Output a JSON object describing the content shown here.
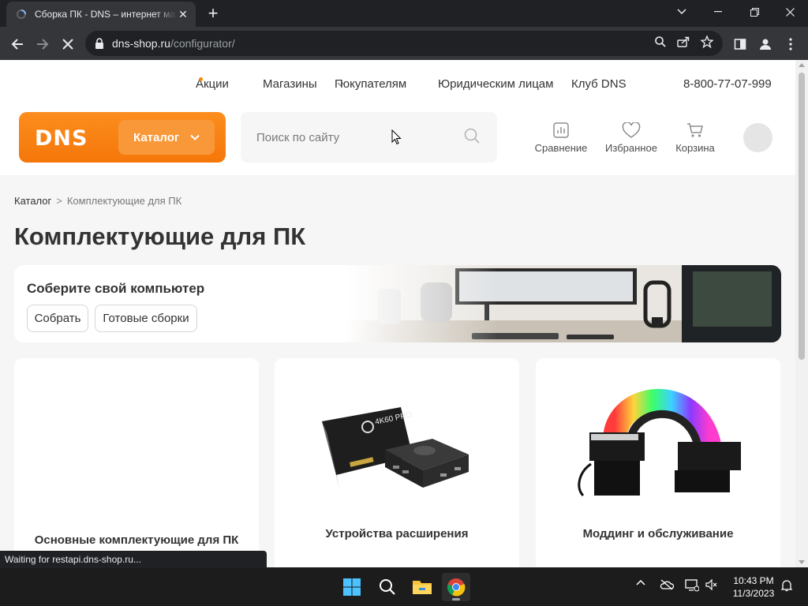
{
  "browser": {
    "tab_title": "Сборка ПК - DNS – интернет магазин",
    "url_domain": "dns-shop.ru",
    "url_path": "/configurator/",
    "status_text": "Waiting for restapi.dns-shop.ru..."
  },
  "site": {
    "brand_color": "#fc8507",
    "topnav": {
      "promo": "Акции",
      "stores": "Магазины",
      "buyers": "Покупателям",
      "legal": "Юридическим лицам",
      "club": "Клуб DNS",
      "phone": "8-800-77-07-999"
    },
    "logo": "DNS",
    "catalog_button": "Каталог",
    "search_placeholder": "Поиск по сайту",
    "header_actions": {
      "compare": "Сравнение",
      "favorites": "Избранное",
      "cart": "Корзина"
    }
  },
  "page": {
    "breadcrumb": {
      "root": "Каталог",
      "separator": ">",
      "current": "Комплектующие для ПК"
    },
    "title": "Комплектующие для ПК",
    "banner": {
      "heading": "Соберите свой компьютер",
      "build_button": "Собрать",
      "ready_button": "Готовые сборки"
    },
    "cards": [
      {
        "caption": "Основные комплектующие для ПК"
      },
      {
        "caption": "Устройства расширения",
        "image_label": "4K60 PRO"
      },
      {
        "caption": "Моддинг и обслуживание"
      }
    ]
  },
  "taskbar": {
    "time": "10:43 PM",
    "date": "11/3/2023"
  }
}
